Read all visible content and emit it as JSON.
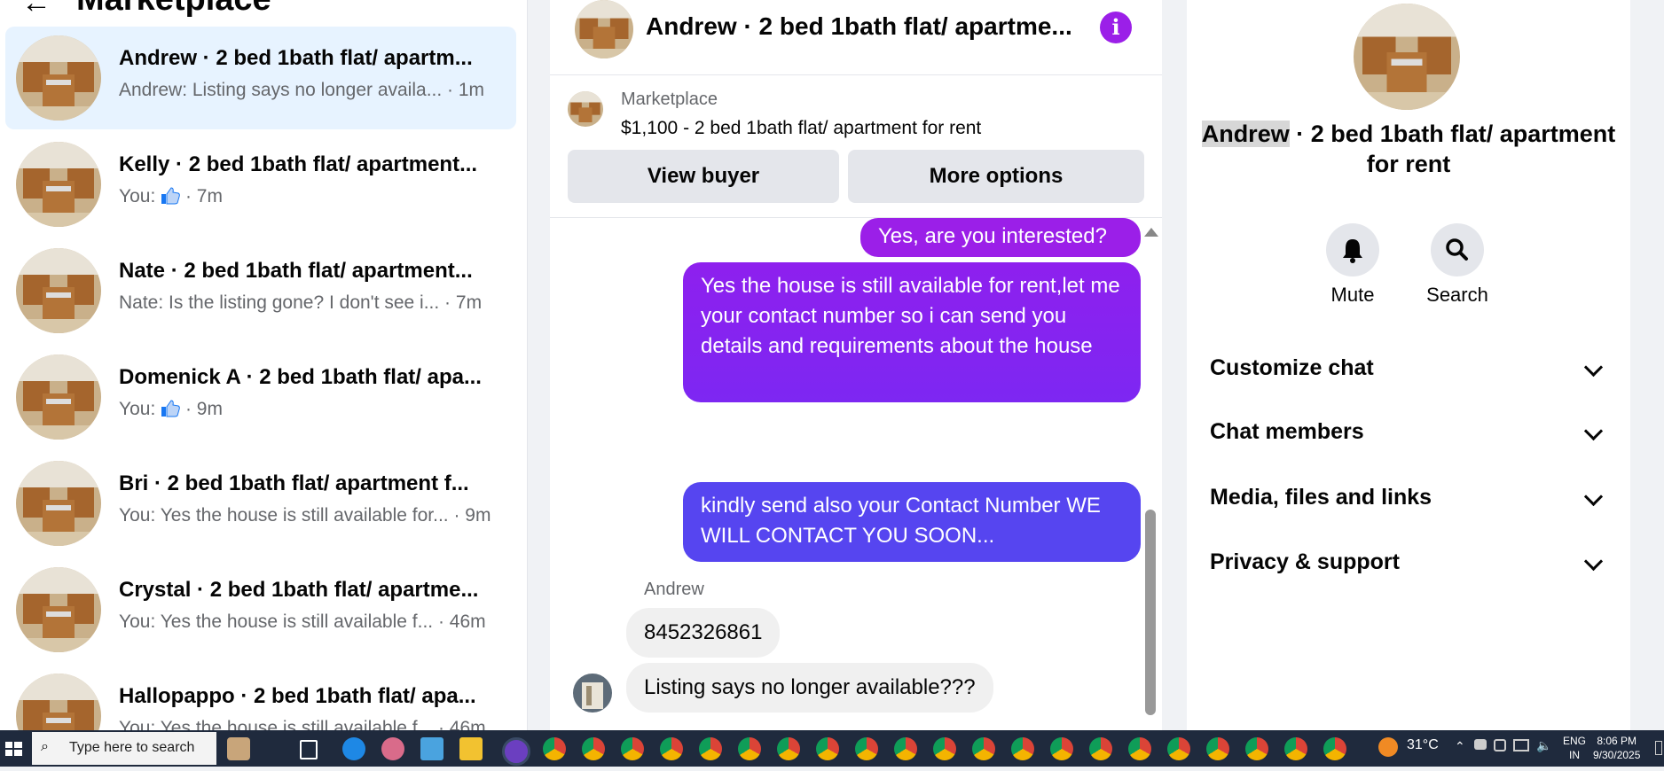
{
  "left_panel": {
    "title": "Marketplace",
    "conversations": [
      {
        "name": "Andrew · 2 bed 1bath flat/ apartm...",
        "preview": "Andrew: Listing says no longer availa... · 1m",
        "active": true
      },
      {
        "name": "Kelly · 2 bed 1bath flat/ apartment...",
        "prefix": "You: ",
        "suffix": " · 7m",
        "thumbs_up": true
      },
      {
        "name": "Nate · 2 bed 1bath flat/ apartment...",
        "preview": "Nate: Is the listing gone? I don't see i... · 7m"
      },
      {
        "name": "Domenick A · 2 bed 1bath flat/ apa...",
        "prefix": "You: ",
        "suffix": " · 9m",
        "thumbs_up": true
      },
      {
        "name": "Bri · 2 bed 1bath flat/ apartment f...",
        "preview": "You: Yes the house is still available for... · 9m"
      },
      {
        "name": "Crystal · 2 bed 1bath flat/ apartme...",
        "preview": "You: Yes the house is still available f... · 46m"
      },
      {
        "name": "Hallopappo · 2 bed 1bath flat/ apa...",
        "preview": "You: Yes the house is still available f... · 46m"
      }
    ]
  },
  "chat": {
    "title": "Andrew · 2 bed 1bath flat/ apartme...",
    "listing_label": "Marketplace",
    "listing_price": "$1,100 - 2 bed 1bath flat/ apartment for rent",
    "view_buyer": "View buyer",
    "more_options": "More options",
    "messages": {
      "out1": "Yes, are you interested?",
      "out2": "Yes the house is still available for rent,let me your contact number so i can send you details and requirements about the house",
      "out3": "kindly send also your Contact Number WE WILL CONTACT YOU SOON...",
      "sender": "Andrew",
      "in1": "8452326861",
      "in2": "Listing says no longer available???"
    }
  },
  "right_panel": {
    "title_highlight": "Andrew",
    "title_rest": " · 2 bed 1bath flat/ apartment for rent",
    "mute_label": "Mute",
    "search_label": "Search",
    "sections": [
      "Customize chat",
      "Chat members",
      "Media, files and links",
      "Privacy & support"
    ]
  },
  "taskbar": {
    "search_placeholder": "Type here to search",
    "weather": "31°C",
    "lang": "ENG",
    "region": "IN",
    "time": "8:06 PM",
    "date": "9/30/2025"
  },
  "colors": {
    "accent_purple": "#9b1fe8",
    "bubble_top": "#9b1fe8",
    "bubble_bottom": "#5a45f5",
    "active_row": "#e7f3ff",
    "taskbar": "#1f2a3d"
  }
}
